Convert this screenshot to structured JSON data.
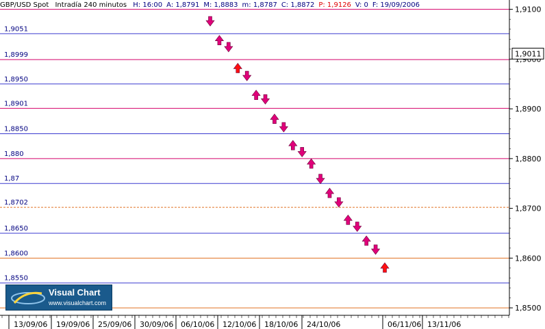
{
  "header": {
    "symbol": "GBP/USD Spot",
    "source": "Intradía 240 minutos",
    "fields": [
      {
        "label": "H",
        "value": "16:00"
      },
      {
        "label": "A",
        "value": "1,8791"
      },
      {
        "label": "M",
        "value": "1,8883"
      },
      {
        "label": "m",
        "value": "1,8787"
      },
      {
        "label": "C",
        "value": "1,8872"
      },
      {
        "label": "P",
        "value": "1,9126"
      },
      {
        "label": "V",
        "value": "0"
      },
      {
        "label": "F",
        "value": "19/09/2006"
      }
    ]
  },
  "logo": {
    "title": "Visual Chart",
    "url": "www.visualchart.com"
  },
  "chart_data": {
    "type": "scatter",
    "y_axis": {
      "range": [
        1.8485,
        1.9105
      ],
      "ticks": [
        "1,9100",
        "1,9000",
        "1,8900",
        "1,8800",
        "1,8700",
        "1,8600",
        "1,8500"
      ],
      "tick_values": [
        1.91,
        1.9,
        1.89,
        1.88,
        1.87,
        1.86,
        1.85
      ],
      "current_value": 1.9011,
      "current_label": "1,9011"
    },
    "x_axis": {
      "ticks": [
        "13/09/06",
        "19/09/06",
        "25/09/06",
        "30/09/06",
        "06/10/06",
        "12/10/06",
        "18/10/06",
        "24/10/06",
        "06/11/06",
        "13/11/06"
      ]
    },
    "levels": [
      {
        "value": 1.91,
        "label": "",
        "color": "#d4006a"
      },
      {
        "value": 1.9051,
        "label": "1,9051",
        "color": "#3a3ad0"
      },
      {
        "value": 1.8999,
        "label": "1,8999",
        "color": "#d4006a"
      },
      {
        "value": 1.895,
        "label": "1,8950",
        "color": "#3a3ad0"
      },
      {
        "value": 1.8901,
        "label": "1,8901",
        "color": "#d4006a"
      },
      {
        "value": 1.885,
        "label": "1,8850",
        "color": "#3a3ad0"
      },
      {
        "value": 1.88,
        "label": "1,880",
        "color": "#d4006a"
      },
      {
        "value": 1.875,
        "label": "1,87",
        "color": "#3a3ad0"
      },
      {
        "value": 1.8702,
        "label": "1,8702",
        "color": "#e07020"
      },
      {
        "value": 1.865,
        "label": "1,8650",
        "color": "#3a3ad0"
      },
      {
        "value": 1.86,
        "label": "1,8600",
        "color": "#e07020"
      },
      {
        "value": 1.855,
        "label": "1,8550",
        "color": "#3a3ad0"
      },
      {
        "value": 1.85,
        "label": "",
        "color": "#e07020"
      }
    ],
    "signals": [
      {
        "type": "sell",
        "y": 1.9076,
        "color": "#e0007a"
      },
      {
        "type": "buy",
        "y": 1.9038,
        "color": "#e0007a"
      },
      {
        "type": "sell",
        "y": 1.9024,
        "color": "#e0007a"
      },
      {
        "type": "buy",
        "y": 1.8982,
        "color": "#ff1010"
      },
      {
        "type": "sell",
        "y": 1.8966,
        "color": "#e0007a"
      },
      {
        "type": "buy",
        "y": 1.8928,
        "color": "#e0007a"
      },
      {
        "type": "sell",
        "y": 1.8919,
        "color": "#e0007a"
      },
      {
        "type": "buy",
        "y": 1.888,
        "color": "#e0007a"
      },
      {
        "type": "sell",
        "y": 1.8863,
        "color": "#e0007a"
      },
      {
        "type": "buy",
        "y": 1.8827,
        "color": "#e0007a"
      },
      {
        "type": "sell",
        "y": 1.8813,
        "color": "#e0007a"
      },
      {
        "type": "buy",
        "y": 1.879,
        "color": "#e0007a"
      },
      {
        "type": "sell",
        "y": 1.8759,
        "color": "#e0007a"
      },
      {
        "type": "buy",
        "y": 1.8731,
        "color": "#e0007a"
      },
      {
        "type": "sell",
        "y": 1.8712,
        "color": "#e0007a"
      },
      {
        "type": "buy",
        "y": 1.8677,
        "color": "#e0007a"
      },
      {
        "type": "sell",
        "y": 1.8663,
        "color": "#e0007a"
      },
      {
        "type": "buy",
        "y": 1.8635,
        "color": "#e0007a"
      },
      {
        "type": "sell",
        "y": 1.8617,
        "color": "#e0007a"
      },
      {
        "type": "buy",
        "y": 1.8581,
        "color": "#ff1010"
      }
    ],
    "grid": false,
    "legend": "none"
  }
}
